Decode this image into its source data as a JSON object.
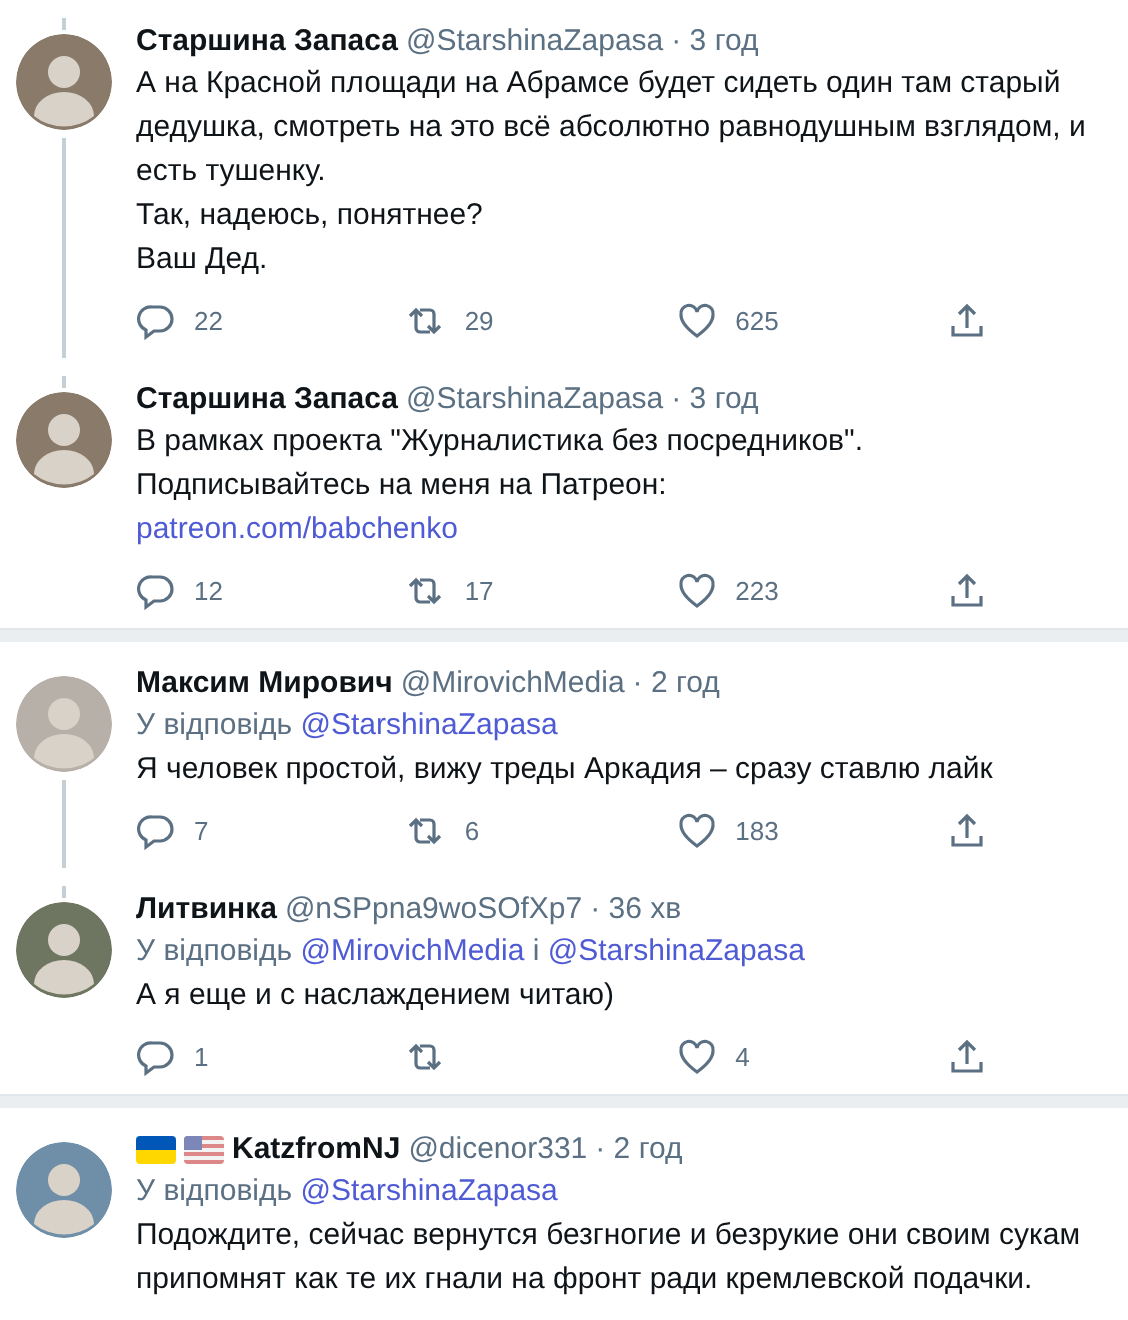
{
  "tweets": [
    {
      "name": "Старшина Запаса",
      "handle": "@StarshinaZapasa",
      "time": "· 3 год",
      "thread_above": true,
      "thread_below": true,
      "paragraphs": [
        "А на Красной площади на Абрамсе будет сидеть один там старый дедушка, смотреть на это всё абсолютно равнодушным взглядом, и есть тушенку.",
        "Так, надеюсь, понятнее?",
        "Ваш Дед."
      ],
      "actions": {
        "reply": "22",
        "retweet": "29",
        "like": "625"
      }
    },
    {
      "name": "Старшина Запаса",
      "handle": "@StarshinaZapasa",
      "time": "· 3 год",
      "thread_above": true,
      "thread_below": false,
      "paragraphs": [
        "В рамках проекта \"Журналистика без посредников\".",
        "Подписывайтесь на меня на Патреон:"
      ],
      "link": "patreon.com/babchenko",
      "actions": {
        "reply": "12",
        "retweet": "17",
        "like": "223"
      },
      "separator_after": true
    },
    {
      "name": "Максим Мирович",
      "handle": "@MirovichMedia",
      "time": "· 2 год",
      "thread_above": false,
      "thread_below": true,
      "reply_prefix": "У відповідь",
      "reply_to": [
        "@StarshinaZapasa"
      ],
      "paragraphs": [
        "Я человек простой, вижу треды Аркадия – сразу ставлю лайк"
      ],
      "actions": {
        "reply": "7",
        "retweet": "6",
        "like": "183"
      }
    },
    {
      "name": "Литвинка",
      "handle": "@nSPpna9woSOfXp7",
      "time": "· 36 хв",
      "thread_above": true,
      "thread_below": false,
      "reply_prefix": "У відповідь",
      "reply_to": [
        "@MirovichMedia",
        "@StarshinaZapasa"
      ],
      "reply_joiner": "і",
      "paragraphs": [
        "А я еще и с наслаждением читаю)"
      ],
      "actions": {
        "reply": "1",
        "like": "4"
      },
      "separator_after": true
    },
    {
      "name": "KatzfromNJ",
      "flags": [
        {
          "kind": "ukraine"
        },
        {
          "kind": "usa"
        }
      ],
      "handle": "@dicenor331",
      "time": "· 2 год",
      "thread_above": false,
      "thread_below": false,
      "reply_prefix": "У відповідь",
      "reply_to": [
        "@StarshinaZapasa"
      ],
      "paragraphs": [
        "Подождите, сейчас вернутся безгногие и безрукие они своим сукам припомнят как те их гнали на фронт ради кремлевской подачки."
      ]
    }
  ]
}
